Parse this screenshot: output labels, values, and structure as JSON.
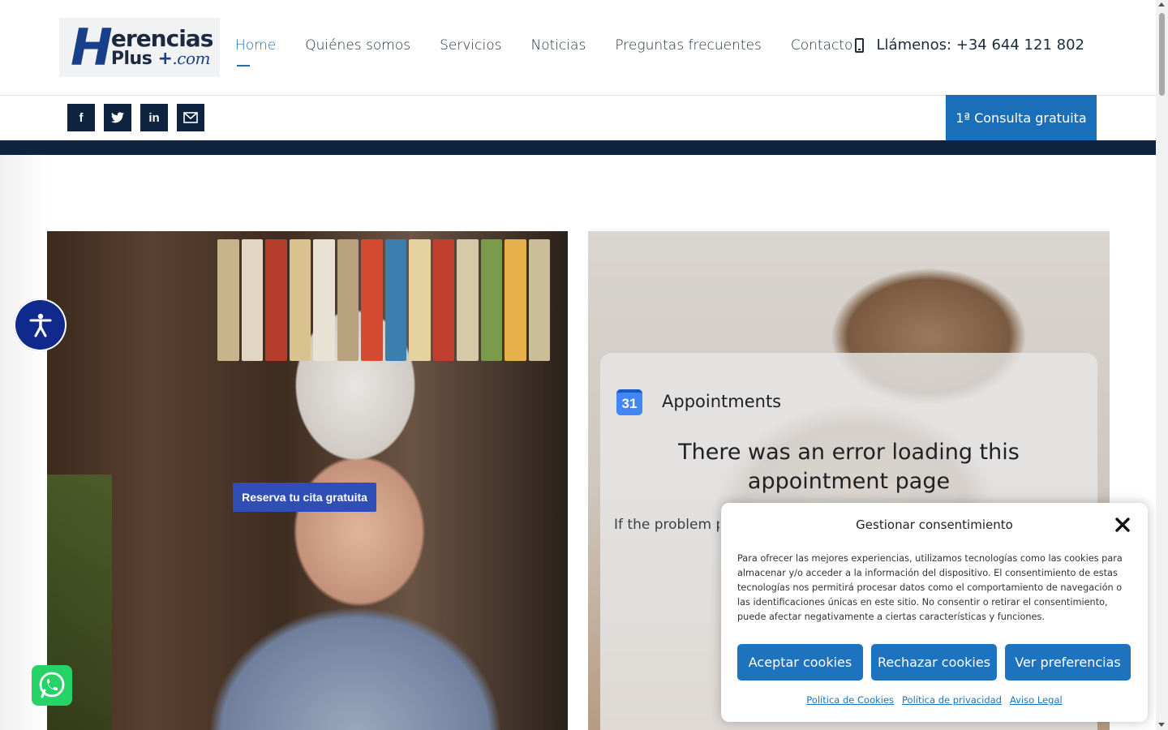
{
  "logo": {
    "letter": "H",
    "line1": "erencias",
    "line2_word": "Plus",
    "line2_plus": "+",
    "line2_domain": ".com"
  },
  "nav": {
    "items": [
      {
        "label": "Home",
        "active": true
      },
      {
        "label": "Quiénes somos"
      },
      {
        "label": "Servicios"
      },
      {
        "label": "Noticias"
      },
      {
        "label": "Preguntas frecuentes"
      },
      {
        "label": "Contacto"
      }
    ]
  },
  "phone": {
    "label": "Llámenos: +34 644 121 802",
    "icon": "phone-icon"
  },
  "social": [
    {
      "glyph": "f",
      "icon": "facebook-icon"
    },
    {
      "glyph": "t",
      "icon": "twitter-icon"
    },
    {
      "glyph": "in",
      "icon": "linkedin-icon"
    },
    {
      "glyph": "✉",
      "icon": "mail-icon"
    }
  ],
  "cta_top": "1ª Consulta gratuita",
  "hero_left": {
    "button": "Reserva tu cita gratuita"
  },
  "appointments": {
    "icon_number": "31",
    "title": "Appointments",
    "error": "There was an error loading this appointment page",
    "message": "If the problem pe"
  },
  "cookie": {
    "title": "Gestionar consentimiento",
    "text": "Para ofrecer las mejores experiencias, utilizamos tecnologías como las cookies para almacenar y/o acceder a la información del dispositivo. El consentimiento de estas tecnologías nos permitirá procesar datos como el comportamiento de navegación o las identificaciones únicas en este sitio. No consentir o retirar el consentimiento, puede afectar negativamente a ciertas características y funciones.",
    "buttons": {
      "accept": "Aceptar cookies",
      "reject": "Rechazar cookies",
      "prefs": "Ver preferencias"
    },
    "links": {
      "cookies": "Política de Cookies",
      "privacy": "Política de privacidad",
      "legal": "Aviso Legal"
    }
  },
  "colors": {
    "navy": "#0d2340",
    "blue": "#1b6fb8",
    "cookie_blue": "#1e73be",
    "a11y": "#0f2a8c",
    "whatsapp": "#25d366"
  }
}
